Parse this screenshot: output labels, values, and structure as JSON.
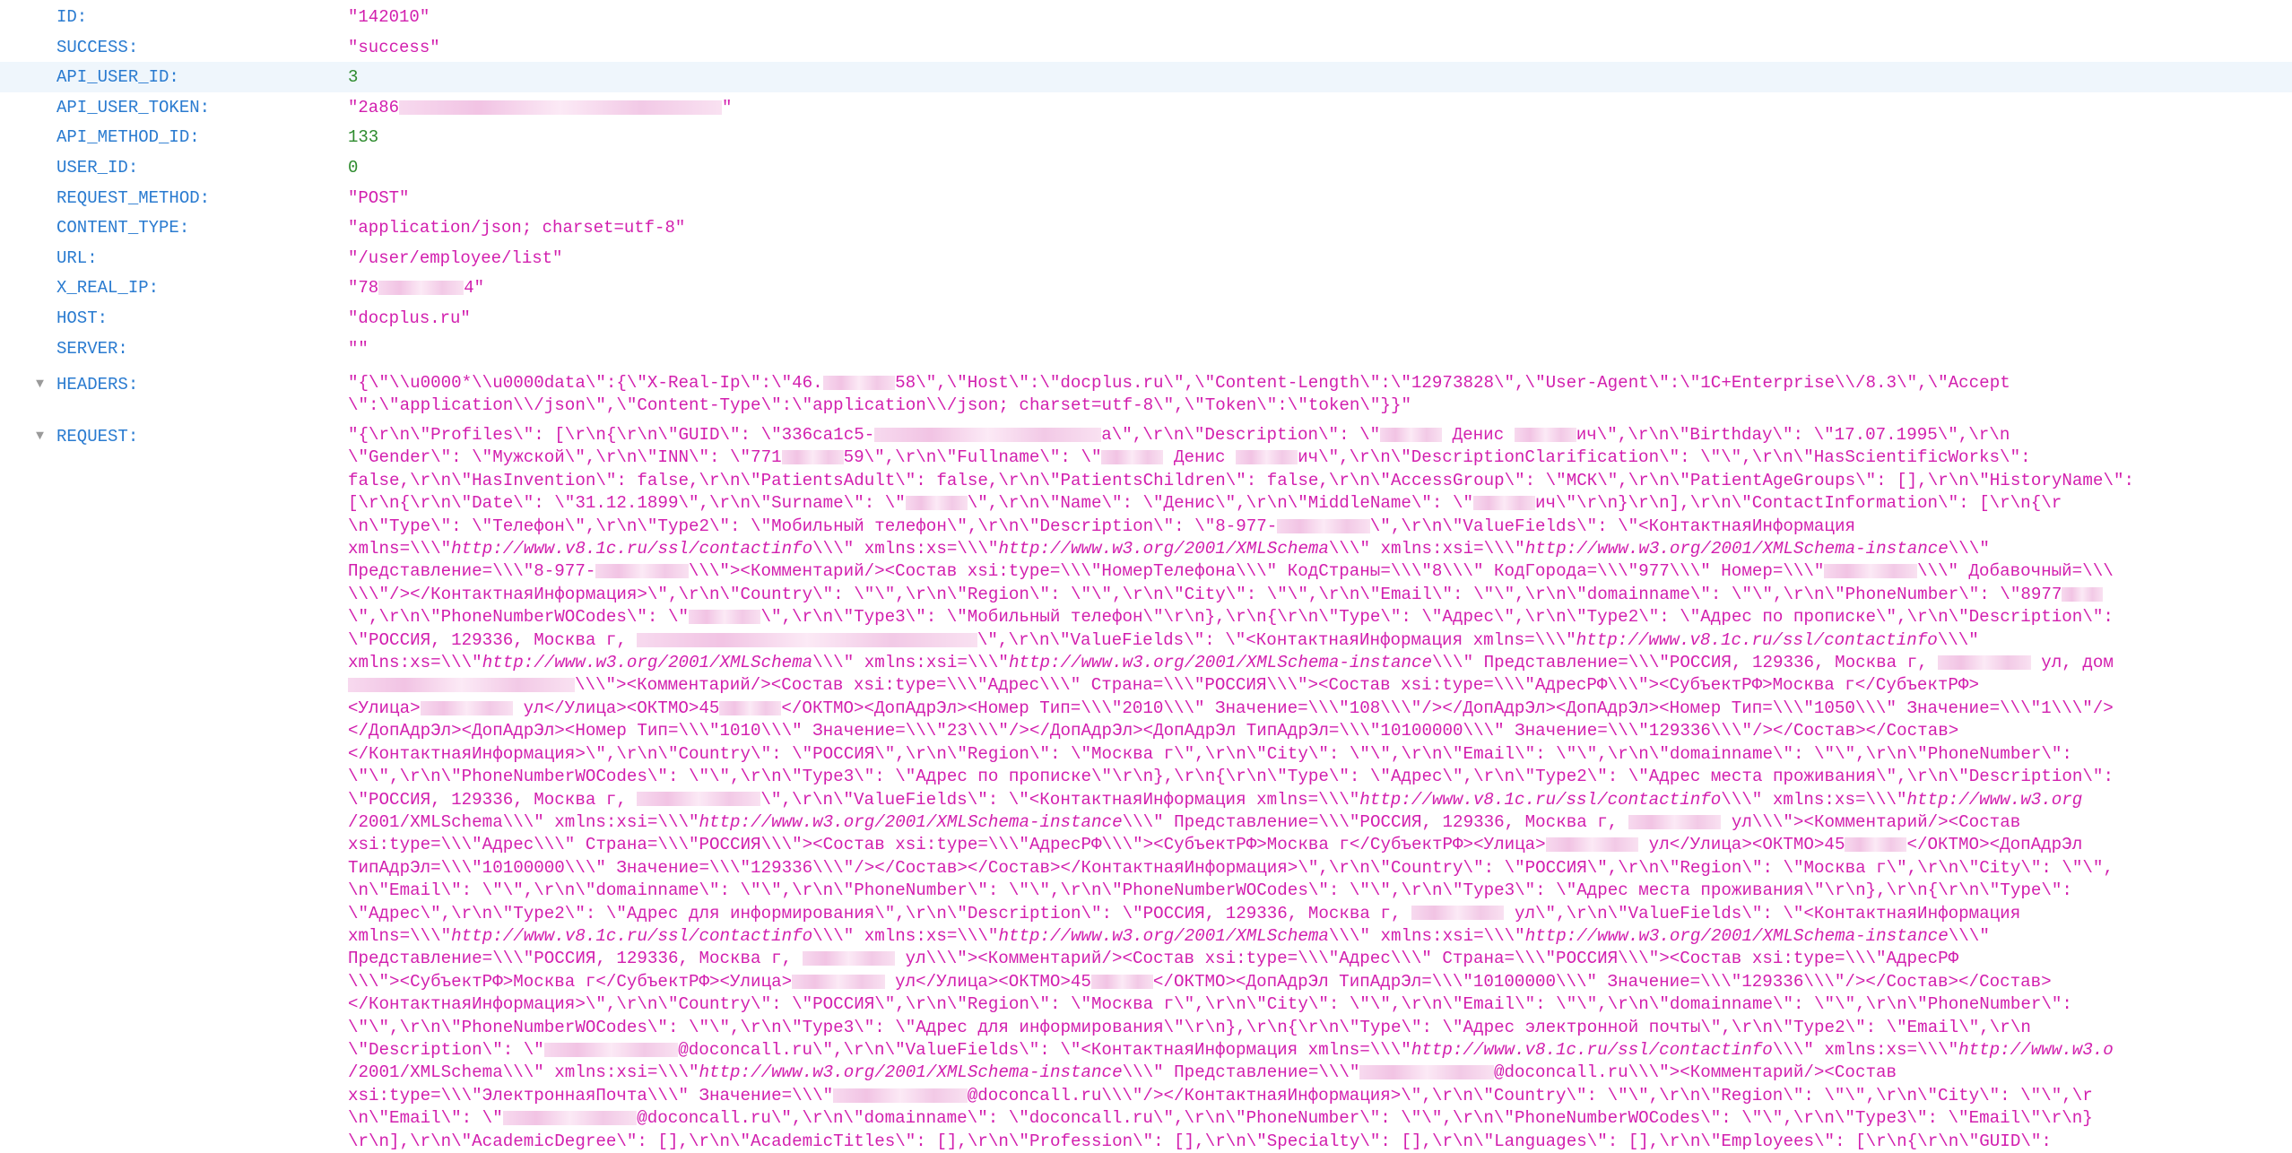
{
  "fields": [
    {
      "key": "ID:",
      "value": "\"142010\"",
      "type": "string"
    },
    {
      "key": "SUCCESS:",
      "value": "\"success\"",
      "type": "string"
    },
    {
      "key": "API_USER_ID:",
      "value": "3",
      "type": "number",
      "highlighted": true
    },
    {
      "key": "API_USER_TOKEN:",
      "value_prefix": "\"2a86",
      "value_suffix": "\"",
      "redacted": true,
      "type": "string"
    },
    {
      "key": "API_METHOD_ID:",
      "value": "133",
      "type": "number"
    },
    {
      "key": "USER_ID:",
      "value": "0",
      "type": "number"
    },
    {
      "key": "REQUEST_METHOD:",
      "value": "\"POST\"",
      "type": "string"
    },
    {
      "key": "CONTENT_TYPE:",
      "value": "\"application/json; charset=utf-8\"",
      "type": "string"
    },
    {
      "key": "URL:",
      "value": "\"/user/employee/list\"",
      "type": "string"
    },
    {
      "key": "X_REAL_IP:",
      "value_prefix": "\"78",
      "value_suffix": "4\"",
      "redacted": true,
      "type": "string"
    },
    {
      "key": "HOST:",
      "value": "\"docplus.ru\"",
      "type": "string"
    },
    {
      "key": "SERVER:",
      "value": "\"\"",
      "type": "string"
    }
  ],
  "headers": {
    "key": "HEADERS:",
    "toggle_icon": "triangle-down",
    "lines": [
      "\"{\\\"\\\\u0000*\\\\u0000data\\\":{\\\"X-Real-Ip\\\":\\\"46.███████58\\\",\\\"Host\\\":\\\"docplus.ru\\\",\\\"Content-Length\\\":\\\"12973828\\\",\\\"User-Agent\\\":\\\"1C+Enterprise\\\\/8.3\\\",\\\"Accept",
      "\\\":\\\"application\\\\/json\\\",\\\"Content-Type\\\":\\\"application\\\\/json; charset=utf-8\\\",\\\"Token\\\":\\\"token\\\"}}\""
    ]
  },
  "request": {
    "key": "REQUEST:",
    "toggle_icon": "triangle-down",
    "lines": [
      "\"{\\r\\n\\\"Profiles\\\": [\\r\\n{\\r\\n\\\"GUID\\\": \\\"336ca1c5-██████████████████████a\\\",\\r\\n\\\"Description\\\": \\\"██████ Денис ██████ич\\\",\\r\\n\\\"Birthday\\\": \\\"17.07.1995\\\",\\r\\n",
      "\\\"Gender\\\": \\\"Мужской\\\",\\r\\n\\\"INN\\\": \\\"771██████59\\\",\\r\\n\\\"Fullname\\\": \\\"██████ Денис ██████ич\\\",\\r\\n\\\"DescriptionClarification\\\": \\\"\\\",\\r\\n\\\"HasScientificWorks\\\":",
      "false,\\r\\n\\\"HasInvention\\\": false,\\r\\n\\\"PatientsAdult\\\": false,\\r\\n\\\"PatientsChildren\\\": false,\\r\\n\\\"AccessGroup\\\": \\\"МСК\\\",\\r\\n\\\"PatientAgeGroups\\\": [],\\r\\n\\\"HistoryName\\\":",
      "[\\r\\n{\\r\\n\\\"Date\\\": \\\"31.12.1899\\\",\\r\\n\\\"Surname\\\": \\\"██████\\\",\\r\\n\\\"Name\\\": \\\"Денис\\\",\\r\\n\\\"MiddleName\\\": \\\"██████ич\\\"\\r\\n}\\r\\n],\\r\\n\\\"ContactInformation\\\": [\\r\\n{\\r",
      "\\n\\\"Type\\\": \\\"Телефон\\\",\\r\\n\\\"Type2\\\": \\\"Мобильный телефон\\\",\\r\\n\\\"Description\\\": \\\"8-977-█████████\\\",\\r\\n\\\"ValueFields\\\": \\\"<КонтактнаяИнформация",
      "xmlns=\\\\\\\"http://www.v8.1c.ru/ssl/contactinfo\\\\\\\" xmlns:xs=\\\\\\\"http://www.w3.org/2001/XMLSchema\\\\\\\" xmlns:xsi=\\\\\\\"http://www.w3.org/2001/XMLSchema-instance\\\\\\\"",
      "Представление=\\\\\\\"8-977-█████████\\\\\\\"><Комментарий/><Состав xsi:type=\\\\\\\"НомерТелефона\\\\\\\" КодСтраны=\\\\\\\"8\\\\\\\" КодГорода=\\\\\\\"977\\\\\\\" Номер=\\\\\\\"█████████\\\\\\\" Добавочный=\\\\\\",
      "\\\\\\\"/></КонтактнаяИнформация>\\\",\\r\\n\\\"Country\\\": \\\"\\\",\\r\\n\\\"Region\\\": \\\"\\\",\\r\\n\\\"City\\\": \\\"\\\",\\r\\n\\\"Email\\\": \\\"\\\",\\r\\n\\\"domainname\\\": \\\"\\\",\\r\\n\\\"PhoneNumber\\\": \\\"8977████",
      "\\\",\\r\\n\\\"PhoneNumberWOCodes\\\": \\\"███████\\\",\\r\\n\\\"Type3\\\": \\\"Мобильный телефон\\\"\\r\\n},\\r\\n{\\r\\n\\\"Type\\\": \\\"Адрес\\\",\\r\\n\\\"Type2\\\": \\\"Адрес по прописке\\\",\\r\\n\\\"Description\\\":",
      "\\\"РОССИЯ, 129336, Москва г, █████████████████████████████████\\\",\\r\\n\\\"ValueFields\\\": \\\"<КонтактнаяИнформация xmlns=\\\\\\\"http://www.v8.1c.ru/ssl/contactinfo\\\\\\\"",
      "xmlns:xs=\\\\\\\"http://www.w3.org/2001/XMLSchema\\\\\\\" xmlns:xsi=\\\\\\\"http://www.w3.org/2001/XMLSchema-instance\\\\\\\" Представление=\\\\\\\"РОССИЯ, 129336, Москва г, █████████ ул, дом",
      "██████████████████████\\\\\\\"><Комментарий/><Состав xsi:type=\\\\\\\"Адрес\\\\\\\" Страна=\\\\\\\"РОССИЯ\\\\\\\"><Состав xsi:type=\\\\\\\"АдресРФ\\\\\\\"><СубъектРФ>Москва г</СубъектРФ>",
      "<Улица>█████████ ул</Улица><ОКТМО>45██████</ОКТМО><ДопАдрЭл><Номер Тип=\\\\\\\"2010\\\\\\\" Значение=\\\\\\\"108\\\\\\\"/></ДопАдрЭл><ДопАдрЭл><Номер Тип=\\\\\\\"1050\\\\\\\" Значение=\\\\\\\"1\\\\\\\"/>",
      "</ДопАдрЭл><ДопАдрЭл><Номер Тип=\\\\\\\"1010\\\\\\\" Значение=\\\\\\\"23\\\\\\\"/></ДопАдрЭл><ДопАдрЭл ТипАдрЭл=\\\\\\\"10100000\\\\\\\" Значение=\\\\\\\"129336\\\\\\\"/></Состав></Состав>",
      "</КонтактнаяИнформация>\\\",\\r\\n\\\"Country\\\": \\\"РОССИЯ\\\",\\r\\n\\\"Region\\\": \\\"Москва г\\\",\\r\\n\\\"City\\\": \\\"\\\",\\r\\n\\\"Email\\\": \\\"\\\",\\r\\n\\\"domainname\\\": \\\"\\\",\\r\\n\\\"PhoneNumber\\\":",
      "\\\"\\\",\\r\\n\\\"PhoneNumberWOCodes\\\": \\\"\\\",\\r\\n\\\"Type3\\\": \\\"Адрес по прописке\\\"\\r\\n},\\r\\n{\\r\\n\\\"Type\\\": \\\"Адрес\\\",\\r\\n\\\"Type2\\\": \\\"Адрес места проживания\\\",\\r\\n\\\"Description\\\":",
      "\\\"РОССИЯ, 129336, Москва г, ████████████\\\",\\r\\n\\\"ValueFields\\\": \\\"<КонтактнаяИнформация xmlns=\\\\\\\"http://www.v8.1c.ru/ssl/contactinfo\\\\\\\" xmlns:xs=\\\\\\\"http://www.w3.org",
      "/2001/XMLSchema\\\\\\\" xmlns:xsi=\\\\\\\"http://www.w3.org/2001/XMLSchema-instance\\\\\\\" Представление=\\\\\\\"РОССИЯ, 129336, Москва г, █████████ ул\\\\\\\"><Комментарий/><Состав",
      "xsi:type=\\\\\\\"Адрес\\\\\\\" Страна=\\\\\\\"РОССИЯ\\\\\\\"><Состав xsi:type=\\\\\\\"АдресРФ\\\\\\\"><СубъектРФ>Москва г</СубъектРФ><Улица>█████████ ул</Улица><ОКТМО>45██████</ОКТМО><ДопАдрЭл",
      "ТипАдрЭл=\\\\\\\"10100000\\\\\\\" Значение=\\\\\\\"129336\\\\\\\"/></Состав></Состав></КонтактнаяИнформация>\\\",\\r\\n\\\"Country\\\": \\\"РОССИЯ\\\",\\r\\n\\\"Region\\\": \\\"Москва г\\\",\\r\\n\\\"City\\\": \\\"\\\",",
      "\\n\\\"Email\\\": \\\"\\\",\\r\\n\\\"domainname\\\": \\\"\\\",\\r\\n\\\"PhoneNumber\\\": \\\"\\\",\\r\\n\\\"PhoneNumberWOCodes\\\": \\\"\\\",\\r\\n\\\"Type3\\\": \\\"Адрес места проживания\\\"\\r\\n},\\r\\n{\\r\\n\\\"Type\\\":",
      "\\\"Адрес\\\",\\r\\n\\\"Type2\\\": \\\"Адрес для информирования\\\",\\r\\n\\\"Description\\\": \\\"РОССИЯ, 129336, Москва г, █████████ ул\\\",\\r\\n\\\"ValueFields\\\": \\\"<КонтактнаяИнформация",
      "xmlns=\\\\\\\"http://www.v8.1c.ru/ssl/contactinfo\\\\\\\" xmlns:xs=\\\\\\\"http://www.w3.org/2001/XMLSchema\\\\\\\" xmlns:xsi=\\\\\\\"http://www.w3.org/2001/XMLSchema-instance\\\\\\\"",
      "Представление=\\\\\\\"РОССИЯ, 129336, Москва г, █████████ ул\\\\\\\"><Комментарий/><Состав xsi:type=\\\\\\\"Адрес\\\\\\\" Страна=\\\\\\\"РОССИЯ\\\\\\\"><Состав xsi:type=\\\\\\\"АдресРФ",
      "\\\\\\\"><СубъектРФ>Москва г</СубъектРФ><Улица>█████████ ул</Улица><ОКТМО>45██████</ОКТМО><ДопАдрЭл ТипАдрЭл=\\\\\\\"10100000\\\\\\\" Значение=\\\\\\\"129336\\\\\\\"/></Состав></Состав>",
      "</КонтактнаяИнформация>\\\",\\r\\n\\\"Country\\\": \\\"РОССИЯ\\\",\\r\\n\\\"Region\\\": \\\"Москва г\\\",\\r\\n\\\"City\\\": \\\"\\\",\\r\\n\\\"Email\\\": \\\"\\\",\\r\\n\\\"domainname\\\": \\\"\\\",\\r\\n\\\"PhoneNumber\\\":",
      "\\\"\\\",\\r\\n\\\"PhoneNumberWOCodes\\\": \\\"\\\",\\r\\n\\\"Type3\\\": \\\"Адрес для информирования\\\"\\r\\n},\\r\\n{\\r\\n\\\"Type\\\": \\\"Адрес электронной почты\\\",\\r\\n\\\"Type2\\\": \\\"Email\\\",\\r\\n",
      "\\\"Description\\\": \\\"█████████████@doconcall.ru\\\",\\r\\n\\\"ValueFields\\\": \\\"<КонтактнаяИнформация xmlns=\\\\\\\"http://www.v8.1c.ru/ssl/contactinfo\\\\\\\" xmlns:xs=\\\\\\\"http://www.w3.o",
      "/2001/XMLSchema\\\\\\\" xmlns:xsi=\\\\\\\"http://www.w3.org/2001/XMLSchema-instance\\\\\\\" Представление=\\\\\\\"█████████████@doconcall.ru\\\\\\\"><Комментарий/><Состав",
      "xsi:type=\\\\\\\"ЭлектроннаяПочта\\\\\\\" Значение=\\\\\\\"█████████████@doconcall.ru\\\\\\\"/></КонтактнаяИнформация>\\\",\\r\\n\\\"Country\\\": \\\"\\\",\\r\\n\\\"Region\\\": \\\"\\\",\\r\\n\\\"City\\\": \\\"\\\",\\r",
      "\\n\\\"Email\\\": \\\"█████████████@doconcall.ru\\\",\\r\\n\\\"domainname\\\": \\\"doconcall.ru\\\",\\r\\n\\\"PhoneNumber\\\": \\\"\\\",\\r\\n\\\"PhoneNumberWOCodes\\\": \\\"\\\",\\r\\n\\\"Type3\\\": \\\"Email\\\"\\r\\n}",
      "\\r\\n],\\r\\n\\\"AcademicDegree\\\": [],\\r\\n\\\"AcademicTitles\\\": [],\\r\\n\\\"Profession\\\": [],\\r\\n\\\"Specialty\\\": [],\\r\\n\\\"Languages\\\": [],\\r\\n\\\"Employees\\\": [\\r\\n{\\r\\n\\\"GUID\\\":"
    ]
  },
  "colors": {
    "key": "#2a7bd0",
    "string": "#d21fae",
    "number": "#2e8b2e",
    "highlight_row": "#eff6fc",
    "toggle": "#9a9a9a"
  }
}
